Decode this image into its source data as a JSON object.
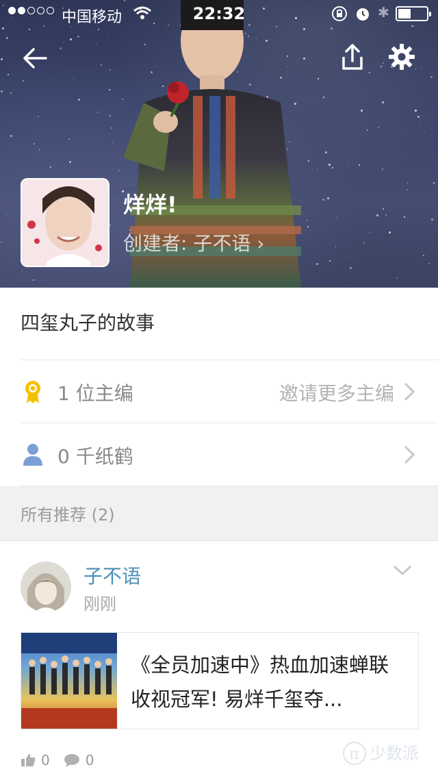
{
  "status_bar": {
    "carrier": "中国移动",
    "time": "22:32",
    "signal_filled": 2,
    "signal_total": 5,
    "battery_level": 0.45,
    "icons": [
      "wifi-icon",
      "rotation-lock-icon",
      "alarm-icon",
      "bluetooth-icon",
      "battery-icon"
    ]
  },
  "header": {
    "back_icon": "arrow-left-icon",
    "share_icon": "share-icon",
    "settings_icon": "gear-icon",
    "title": "烊烊!",
    "creator_link": "创建者: 子不语 ›"
  },
  "collection": {
    "description": "四玺丸子的故事"
  },
  "rows": [
    {
      "icon": "medal-icon",
      "label": "1 位主编",
      "action": "邀请更多主编"
    },
    {
      "icon": "person-icon",
      "label": "0 千纸鹤",
      "action": ""
    }
  ],
  "recommendations": {
    "header": "所有推荐 (2)",
    "items": [
      {
        "author": "子不语",
        "time": "刚刚",
        "article_title": "《全员加速中》热血加速蝉联收视冠军! 易烊千玺夺...",
        "likes": "0",
        "comments": "0"
      }
    ]
  },
  "watermark": "少数派",
  "colors": {
    "link": "#4a8fb8",
    "medal": "#f2c200",
    "person": "#7b9fd4"
  }
}
